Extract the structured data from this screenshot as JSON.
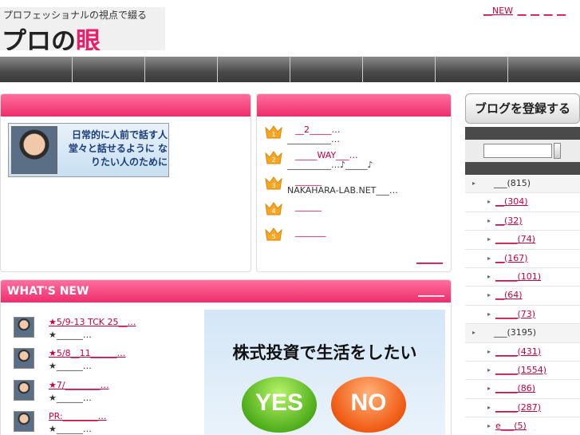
{
  "header": {
    "tagline": "プロフェッショナルの視点で綴る",
    "brand_main": "プロの",
    "brand_accent": "眼",
    "toplinks": [
      "__NEW",
      "__",
      "__",
      "__",
      "__"
    ]
  },
  "nav": {
    "items": [
      "",
      "",
      "",
      "",
      "",
      "",
      "",
      ""
    ]
  },
  "left_panel": {
    "title": "",
    "banner_text": "日常的に人前で話す人 堂々と話せるように なりたい人のために"
  },
  "ranking": {
    "title": "",
    "items": [
      {
        "rank": "1",
        "line1": "__2_____…",
        "line2": "__________…"
      },
      {
        "rank": "2",
        "line1": "_____WAY___…",
        "line2": "__________…♪_____♪"
      },
      {
        "rank": "3",
        "line1": "______",
        "line2": "NAKAHARA-LAB.NET___…"
      },
      {
        "rank": "4",
        "line1": "______",
        "line2": ""
      },
      {
        "rank": "5",
        "line1": "_______",
        "line2": ""
      }
    ],
    "more": "______"
  },
  "whats_new": {
    "title": "WHAT'S NEW",
    "more": "______",
    "items": [
      {
        "title": "★5/9-13 TCK 25__…",
        "sub": "★______…"
      },
      {
        "title": "★5/8__11______…",
        "sub": "★______…"
      },
      {
        "title": "★7/________…",
        "sub": "★______…"
      },
      {
        "title": "PR:________…",
        "sub": "★______…"
      }
    ],
    "promo": {
      "question": "株式投資で生活をしたい",
      "yes": "YES",
      "no": "NO"
    }
  },
  "sidebar": {
    "register_button": "ブログを登録する",
    "categories": [
      {
        "level": "top",
        "label": "___(815)"
      },
      {
        "level": "sub",
        "label": "__(304)"
      },
      {
        "level": "sub",
        "label": "__(32)"
      },
      {
        "level": "sub",
        "label": "_____(74)"
      },
      {
        "level": "sub",
        "label": "__(167)"
      },
      {
        "level": "sub",
        "label": "_____(101)"
      },
      {
        "level": "sub",
        "label": "__(64)"
      },
      {
        "level": "sub",
        "label": "_____(73)"
      },
      {
        "level": "top",
        "label": "___(3195)"
      },
      {
        "level": "sub",
        "label": "_____(431)"
      },
      {
        "level": "sub",
        "label": "_____(1554)"
      },
      {
        "level": "sub",
        "label": "_____(86)"
      },
      {
        "level": "sub",
        "label": "_____(287)"
      },
      {
        "level": "sub",
        "label": "e___(5)"
      }
    ]
  }
}
